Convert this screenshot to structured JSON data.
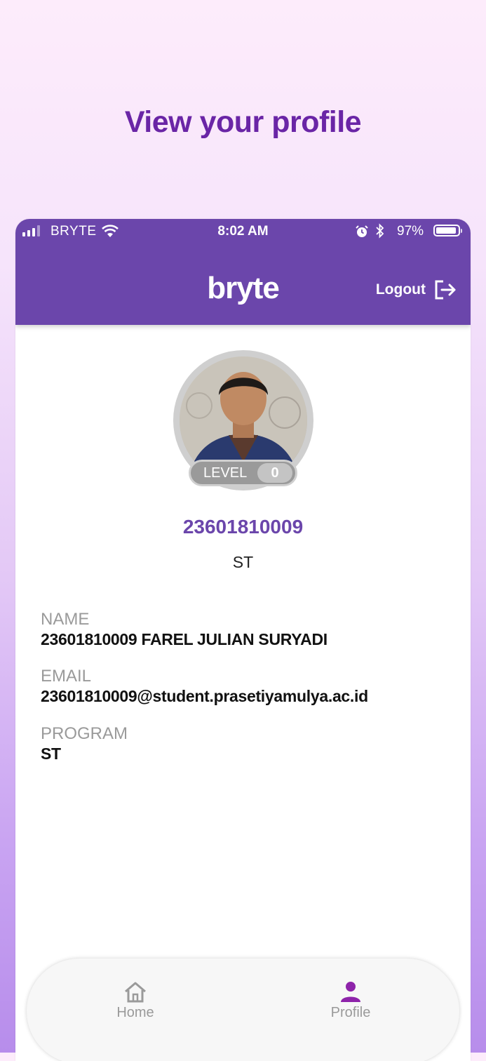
{
  "headline": "View your profile",
  "status_bar": {
    "carrier": "BRYTE",
    "time": "8:02 AM",
    "battery_percent": "97%"
  },
  "header": {
    "logo": "bryte",
    "logout_label": "Logout"
  },
  "profile": {
    "level_label": "LEVEL",
    "level_value": "0",
    "student_id": "23601810009",
    "program_short": "ST"
  },
  "details": [
    {
      "label": "NAME",
      "value": "23601810009 FAREL JULIAN SURYADI"
    },
    {
      "label": "EMAIL",
      "value": "23601810009@student.prasetiyamulya.ac.id"
    },
    {
      "label": "PROGRAM",
      "value": "ST"
    }
  ],
  "bottom_nav": {
    "home_label": "Home",
    "profile_label": "Profile",
    "active": "Profile"
  },
  "colors": {
    "brand": "#6b46ab",
    "headline": "#6a25a6",
    "active_nav": "#8e24aa",
    "inactive_nav": "#9a9a9a"
  },
  "icons": {
    "logout": "logout-icon",
    "home": "home-icon",
    "profile": "person-icon"
  }
}
